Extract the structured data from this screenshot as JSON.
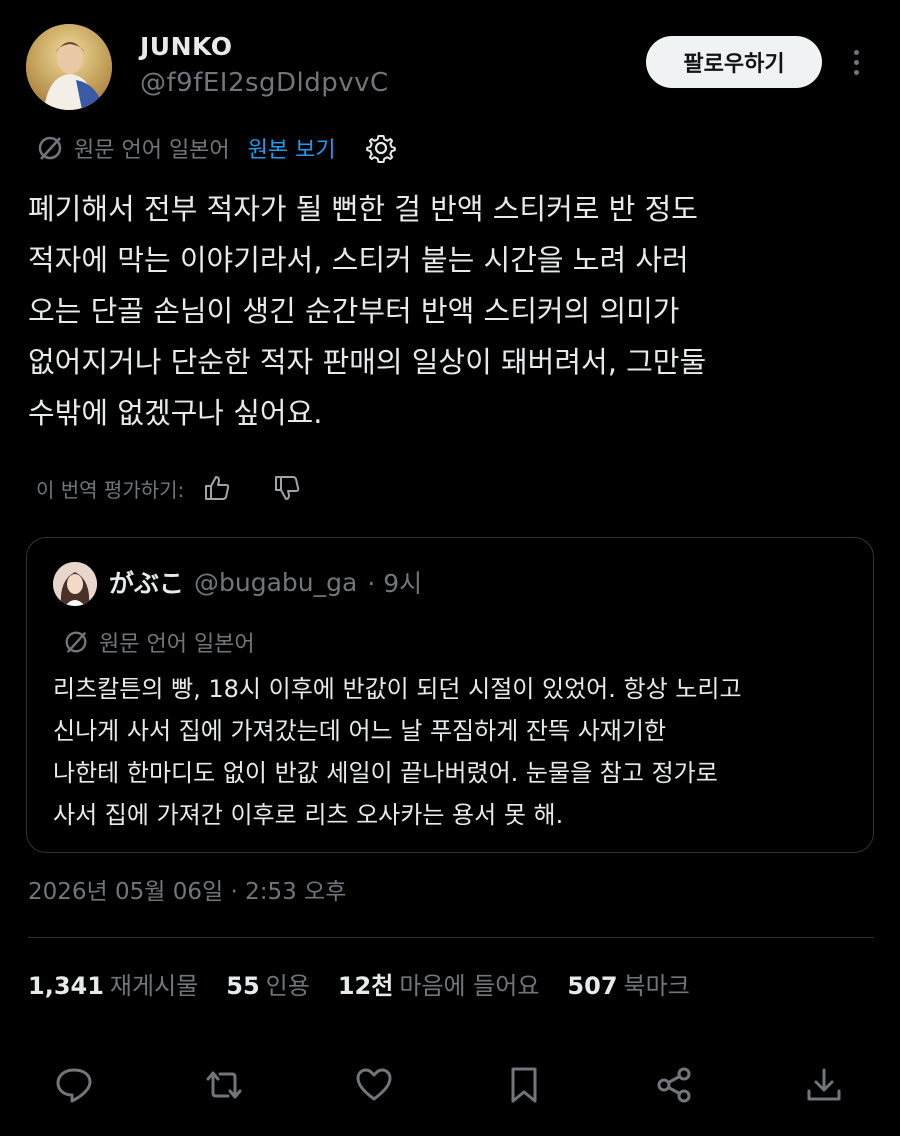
{
  "author": {
    "display_name": "JUNKO",
    "handle": "@f9fEI2sgDldpvvC"
  },
  "header": {
    "follow_label": "팔로우하기"
  },
  "translation": {
    "source_language": "원문 언어 일본어",
    "view_original": "원본 보기"
  },
  "tweet": {
    "text": "폐기해서 전부 적자가 될 뻔한 걸 반액 스티커로 반 정도\n적자에 막는 이야기라서, 스티커 붙는 시간을 노려 사러\n오는 단골 손님이 생긴 순간부터 반액 스티커의 의미가\n없어지거나 단순한 적자 판매의 일상이 돼버려서, 그만둘\n수밖에 없겠구나 싶어요.",
    "rate_translation": "이 번역 평가하기:",
    "timestamp": "2026년 05월 06일 · 2:53 오후"
  },
  "quote": {
    "display_name": "がぶこ",
    "handle": "@bugabu_ga",
    "time": "· 9시",
    "source_language": "원문 언어 일본어",
    "text": "리츠칼튼의 빵, 18시 이후에 반값이 되던 시절이 있었어. 항상 노리고\n신나게 사서 집에 가져갔는데 어느 날 푸짐하게 잔뜩 사재기한\n나한테 한마디도 없이 반값 세일이 끝나버렸어. 눈물을 참고 정가로\n사서 집에 가져간 이후로 리츠 오사카는 용서 못 해."
  },
  "stats": [
    {
      "value": "1,341",
      "label": "재게시물"
    },
    {
      "value": "55",
      "label": "인용"
    },
    {
      "value": "12천",
      "label": "마음에 들어요"
    },
    {
      "value": "507",
      "label": "북마크"
    }
  ],
  "actions": [
    "reply-icon",
    "repost-icon",
    "like-icon",
    "bookmark-icon",
    "share-icon",
    "download-icon"
  ],
  "colors": {
    "background": "#000000",
    "text": "#e7e9ea",
    "muted": "#71767b",
    "link": "#1d9bf0",
    "border": "#2f3336"
  }
}
